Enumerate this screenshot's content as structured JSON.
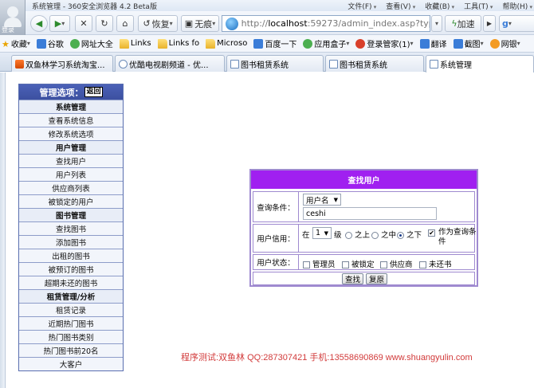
{
  "browser": {
    "window_title": "系统管理 - 360安全浏览器 4.2 Beta版",
    "menus": [
      "文件(F)",
      "查看(V)",
      "收藏(B)",
      "工具(T)",
      "帮助(H)"
    ],
    "avatar_label": "登录",
    "back_label": "",
    "restore_label": "恢复",
    "no_trace_label": "无痕",
    "url_prefix": "http://",
    "url_host": "localhost",
    "url_rest": ":59273/admin_index.asp?typ",
    "accelerate_label": "加速"
  },
  "bookmarks": [
    {
      "label": "收藏",
      "icon": "star-icon"
    },
    {
      "label": "谷歌",
      "icon": "google-icon"
    },
    {
      "label": "网址大全",
      "icon": "web-directory-icon"
    },
    {
      "label": "Links",
      "icon": "folder-icon"
    },
    {
      "label": "Links fo",
      "icon": "folder-icon"
    },
    {
      "label": "Microso",
      "icon": "folder-icon"
    },
    {
      "label": "百度一下",
      "icon": "baidu-icon"
    },
    {
      "label": "应用盒子",
      "icon": "app-box-icon"
    },
    {
      "label": "登录管家(1)",
      "icon": "login-manager-icon"
    },
    {
      "label": "翻译",
      "icon": "translate-icon"
    },
    {
      "label": "截图",
      "icon": "screenshot-icon"
    },
    {
      "label": "网银",
      "icon": "online-bank-icon"
    }
  ],
  "tabs": [
    {
      "label": "双鱼林学习系统淘宝...",
      "active": false
    },
    {
      "label": "优酷电视剧频道 - 优...",
      "active": false
    },
    {
      "label": "图书租赁系统",
      "active": false
    },
    {
      "label": "图书租赁系统",
      "active": false
    },
    {
      "label": "系统管理",
      "active": true
    }
  ],
  "sidebar": {
    "header": "管理选项：",
    "back_button": "返回",
    "items": [
      {
        "label": "系统管理",
        "section": true
      },
      {
        "label": "查看系统信息",
        "section": false
      },
      {
        "label": "修改系统选项",
        "section": false
      },
      {
        "label": "用户管理",
        "section": true
      },
      {
        "label": "查找用户",
        "section": false
      },
      {
        "label": "用户列表",
        "section": false
      },
      {
        "label": "供应商列表",
        "section": false
      },
      {
        "label": "被锁定的用户",
        "section": false
      },
      {
        "label": "图书管理",
        "section": true
      },
      {
        "label": "查找图书",
        "section": false
      },
      {
        "label": "添加图书",
        "section": false
      },
      {
        "label": "出租的图书",
        "section": false
      },
      {
        "label": "被预订的图书",
        "section": false
      },
      {
        "label": "超期未还的图书",
        "section": false
      },
      {
        "label": "租赁管理/分析",
        "section": true
      },
      {
        "label": "租赁记录",
        "section": false
      },
      {
        "label": "近期热门图书",
        "section": false
      },
      {
        "label": "热门图书类别",
        "section": false
      },
      {
        "label": "热门图书前20名",
        "section": false
      },
      {
        "label": "大客户",
        "section": false
      }
    ]
  },
  "find_user": {
    "title": "查找用户",
    "condition_label": "查询条件：",
    "condition_select": "用户名",
    "condition_value": "ceshi",
    "credit_label": "用户信用：",
    "credit_prefix": "在",
    "credit_level": "1",
    "credit_unit": "级",
    "credit_options": [
      {
        "label": "之上",
        "checked": false
      },
      {
        "label": "之中",
        "checked": false
      },
      {
        "label": "之下",
        "checked": true
      }
    ],
    "as_condition_label": "作为查询条件",
    "as_condition_checked": true,
    "status_label": "用户状态：",
    "status_options": [
      {
        "label": "管理员",
        "checked": false
      },
      {
        "label": "被锁定",
        "checked": false
      },
      {
        "label": "供应商",
        "checked": false
      },
      {
        "label": "未还书",
        "checked": false
      }
    ],
    "search_button": "查找",
    "reset_button": "复原"
  },
  "footer": "程序测试:双鱼林 QQ:287307421 手机:13558690869 www.shuangyulin.com"
}
